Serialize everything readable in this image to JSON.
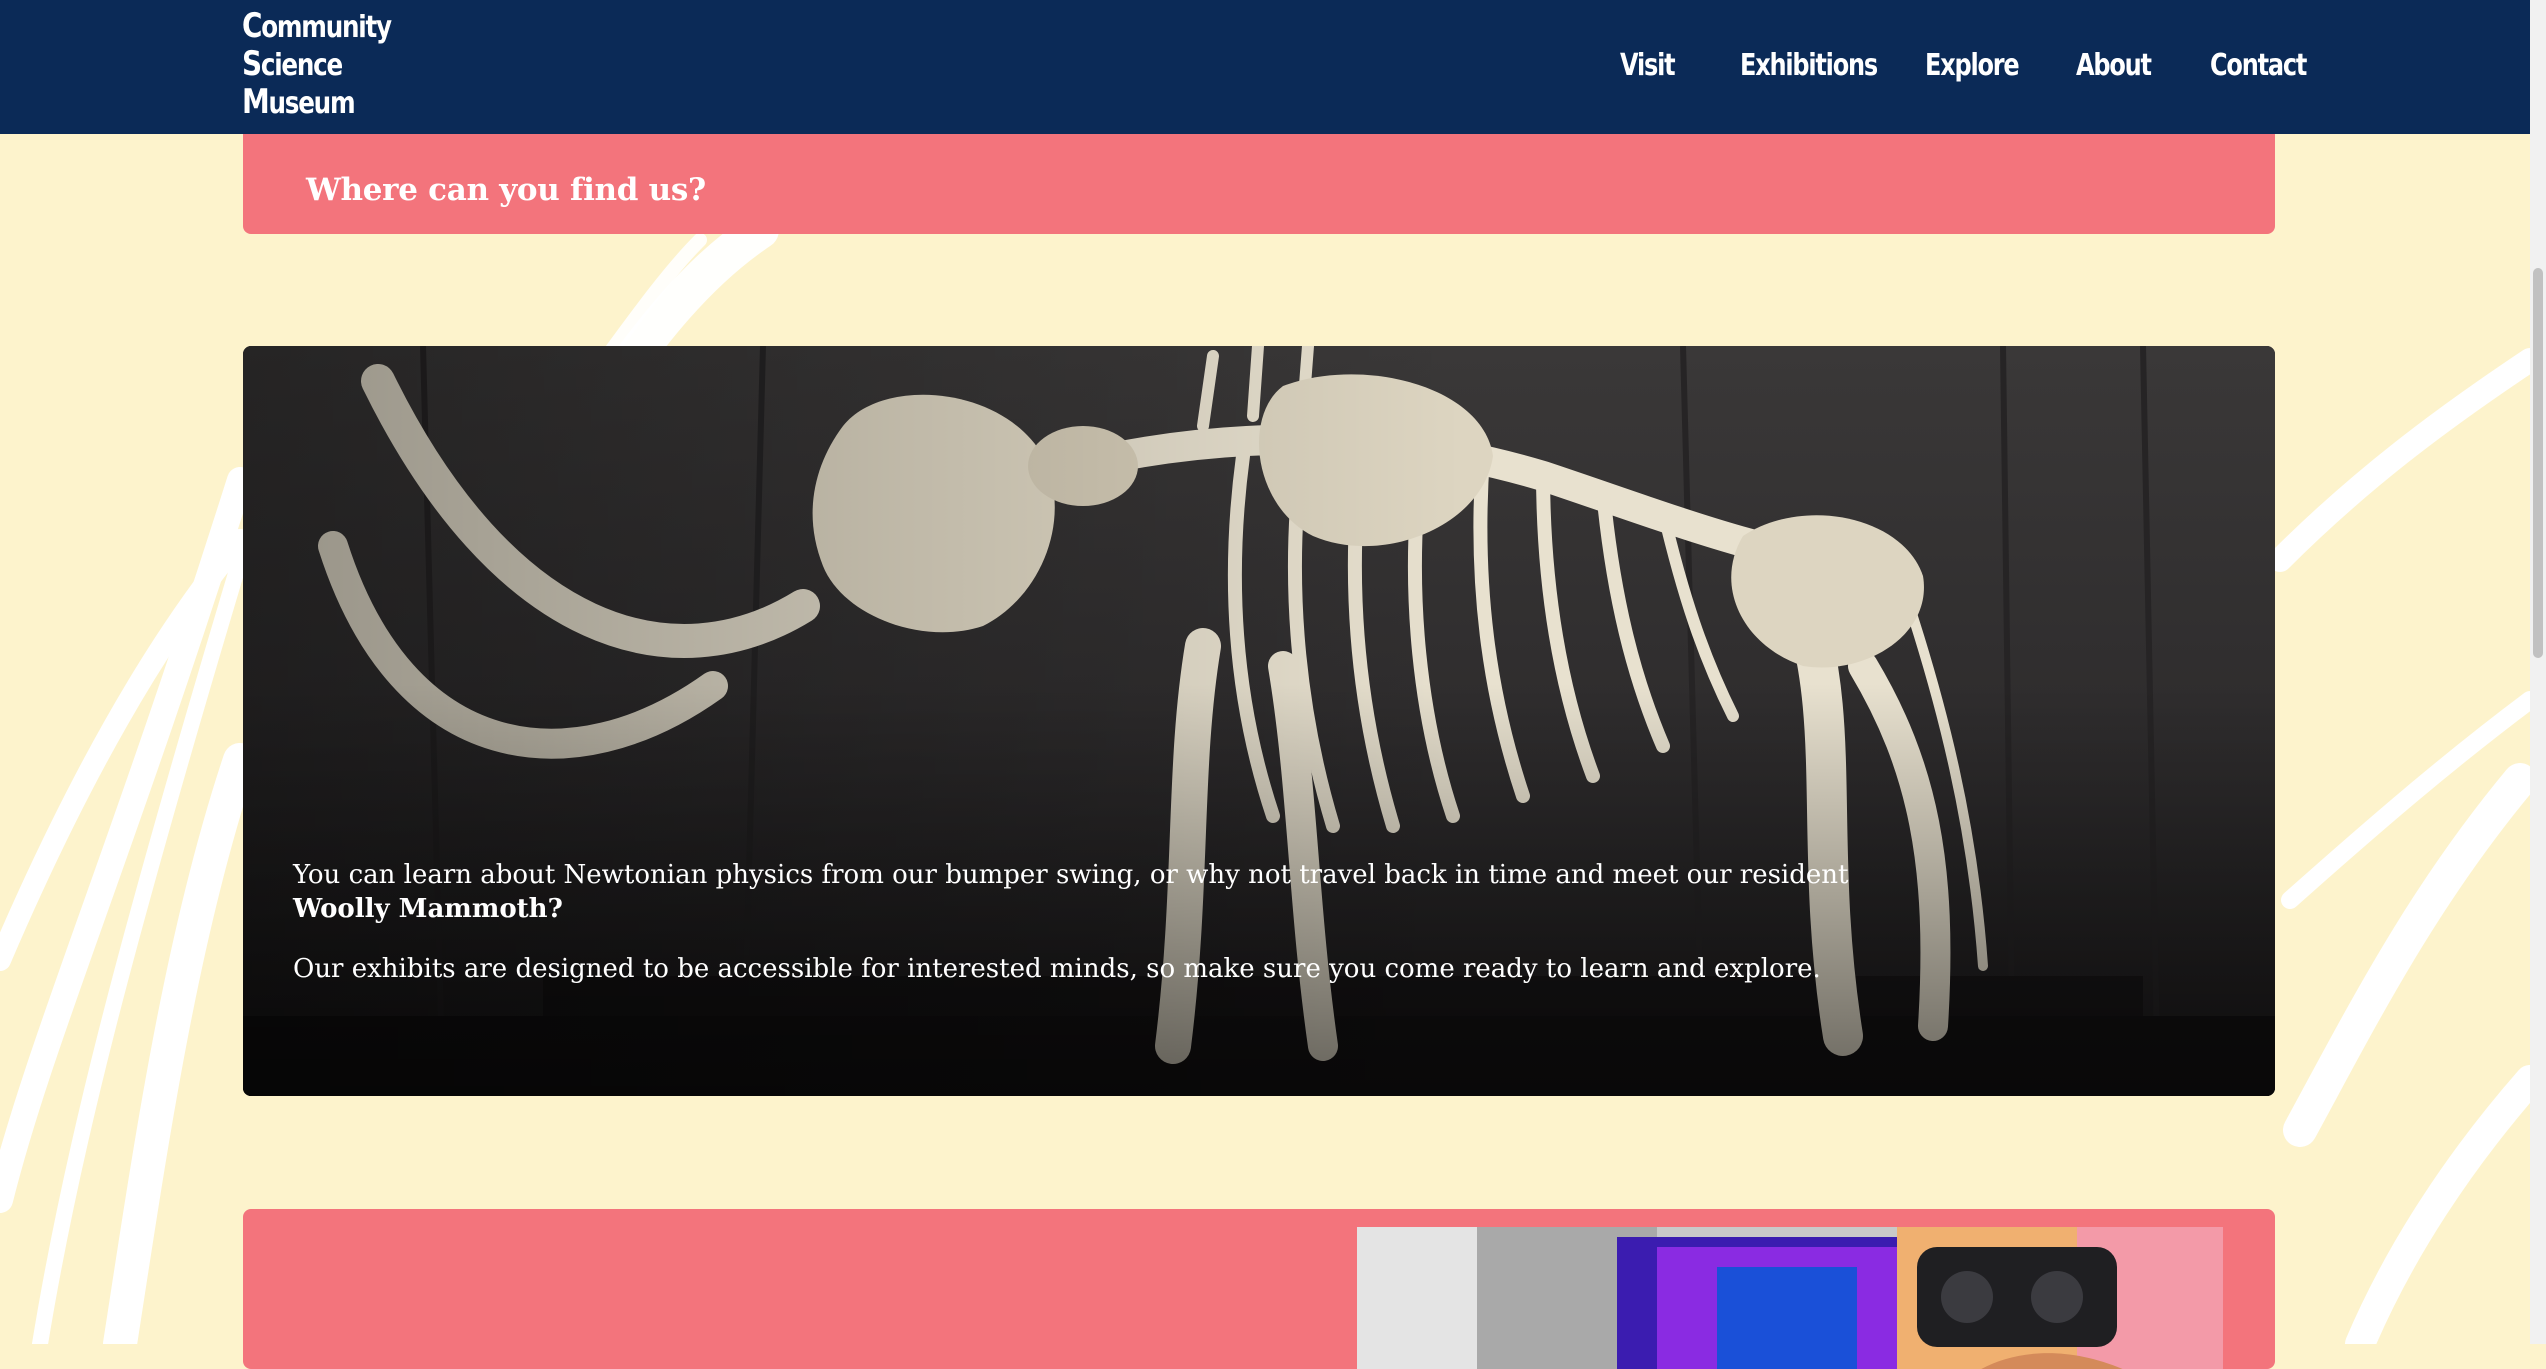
{
  "brand": {
    "lines": [
      {
        "initial": "C",
        "rest": "ommunity"
      },
      {
        "initial": "S",
        "rest": "cience"
      },
      {
        "initial": "M",
        "rest": "useum"
      }
    ]
  },
  "nav": {
    "items": [
      {
        "label": "Visit"
      },
      {
        "label": "Exhibitions"
      },
      {
        "label": "Explore"
      },
      {
        "label": "About"
      },
      {
        "label": "Contact"
      }
    ]
  },
  "banner": {
    "heading": "Where can you find us?"
  },
  "hero": {
    "paragraph1_text": "You can learn about Newtonian physics from our bumper swing, or why not travel back in time and meet our resident ",
    "paragraph1_bold": "Woolly Mammoth?",
    "paragraph2": "Our exhibits are designed to be accessible for interested minds, so make sure you come ready to learn and explore."
  },
  "colors": {
    "header_bg": "#0b2a57",
    "page_bg": "#fdf3cc",
    "accent_pink": "#f3747c",
    "text_light": "#ffffff"
  },
  "icons": {
    "hero_image": "woolly-mammoth-skeleton-photo",
    "promo_image": "vr-headset-photo"
  }
}
